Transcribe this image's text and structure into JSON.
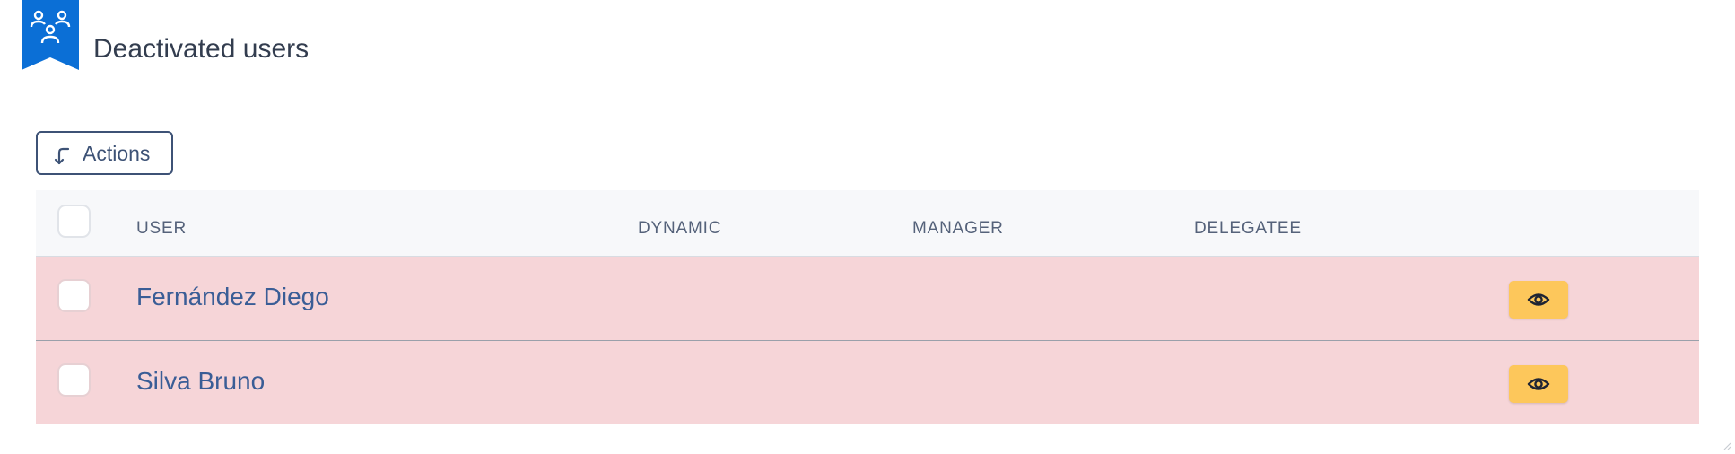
{
  "page": {
    "title": "Deactivated users",
    "icon": "users-group-icon",
    "accent_color": "#0b6fd6"
  },
  "toolbar": {
    "actions_label": "Actions",
    "actions_icon": "arrow-turn-down-left-icon"
  },
  "table": {
    "columns": [
      "USER",
      "DYNAMIC",
      "MANAGER",
      "DELEGATEE"
    ],
    "rows": [
      {
        "user": "Fernández Diego",
        "dynamic": "",
        "manager": "",
        "delegatee": ""
      },
      {
        "user": "Silva Bruno",
        "dynamic": "",
        "manager": "",
        "delegatee": ""
      }
    ],
    "row_action_icon": "eye-icon",
    "row_background": "#f6d5d8",
    "row_action_color": "#fdc75b"
  }
}
